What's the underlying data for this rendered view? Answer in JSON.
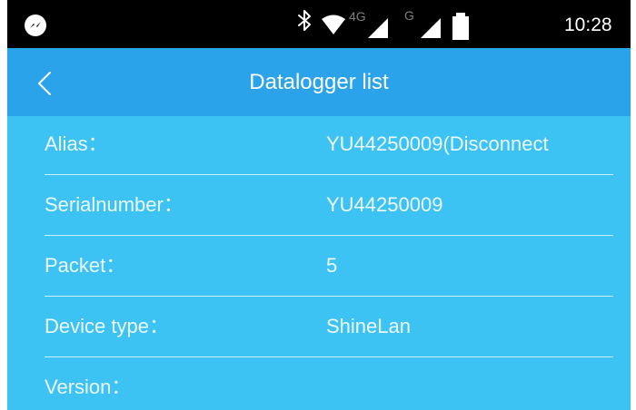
{
  "status_bar": {
    "network_label": "4G",
    "sim2_label": "G",
    "time": "10:28",
    "icons": [
      "messenger-icon",
      "bluetooth-icon",
      "wifi-icon",
      "signal-icon",
      "battery-icon"
    ]
  },
  "header": {
    "title": "Datalogger list",
    "back_icon": "chevron-left-icon"
  },
  "details": [
    {
      "label": "Alias：",
      "value": "YU44250009(Disconnect"
    },
    {
      "label": "Serialnumber：",
      "value": "YU44250009"
    },
    {
      "label": "Packet：",
      "value": "5"
    },
    {
      "label": "Device type：",
      "value": "ShineLan"
    },
    {
      "label": "Version：",
      "value": ""
    }
  ],
  "colors": {
    "status_bar": "#000000",
    "app_bar": "#2aa3ea",
    "content": "#3cc3f4",
    "text": "#ffffff"
  }
}
